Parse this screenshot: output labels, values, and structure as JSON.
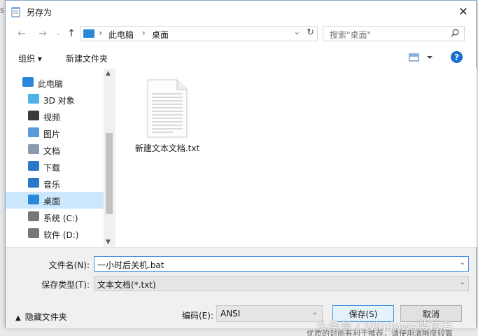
{
  "window": {
    "title": "另存为",
    "close_glyph": "✕",
    "background_edge_text": "s"
  },
  "address": {
    "crumbs": [
      "此电脑",
      "桌面"
    ],
    "sep": "›",
    "dropdown_glyph": "⌄",
    "refresh_glyph": "↻",
    "nav_glyphs": {
      "back": "←",
      "forward": "→",
      "recent": "⌄",
      "up": "↑"
    }
  },
  "search": {
    "placeholder": "搜索\"桌面\"",
    "icon": "search-icon"
  },
  "toolbar": {
    "organize_label": "组织 ▾",
    "new_folder_label": "新建文件夹",
    "help_label": "?"
  },
  "nav": {
    "items": [
      {
        "label": "此电脑",
        "icon": "this-pc-icon"
      },
      {
        "label": "3D 对象",
        "icon": "3d-objects-icon"
      },
      {
        "label": "视频",
        "icon": "videos-icon"
      },
      {
        "label": "图片",
        "icon": "pictures-icon"
      },
      {
        "label": "文档",
        "icon": "documents-icon"
      },
      {
        "label": "下载",
        "icon": "downloads-icon"
      },
      {
        "label": "音乐",
        "icon": "music-icon"
      },
      {
        "label": "桌面",
        "icon": "desktop-icon",
        "selected": true
      },
      {
        "label": "系统 (C:)",
        "icon": "drive-c-icon"
      },
      {
        "label": "软件 (D:)",
        "icon": "drive-d-icon"
      }
    ],
    "scroll_up": "▲",
    "scroll_down": "▼"
  },
  "files": [
    {
      "name": "新建文本文档.txt",
      "icon": "text-file-icon"
    }
  ],
  "form": {
    "filename_label": "文件名(N):",
    "filename_value": "一小时后关机.bat",
    "filetype_label": "保存类型(T):",
    "filetype_value": "文本文档(*.txt)",
    "encoding_label": "编码(E):",
    "encoding_value": "ANSI",
    "save_label": "保存(S)",
    "cancel_label": "取消",
    "hide_folders_label": "隐藏文件夹",
    "drop_glyph": "⌄",
    "hide_glyph": "▲"
  },
  "watermark": "头条号 / Windows装孩者",
  "background_caption": "优质的封面有利于推荐，请使用清晰度较高",
  "colors": {
    "accent": "#1c6fd1",
    "selection": "#cce8ff",
    "focus_border": "#3c8ee2"
  }
}
